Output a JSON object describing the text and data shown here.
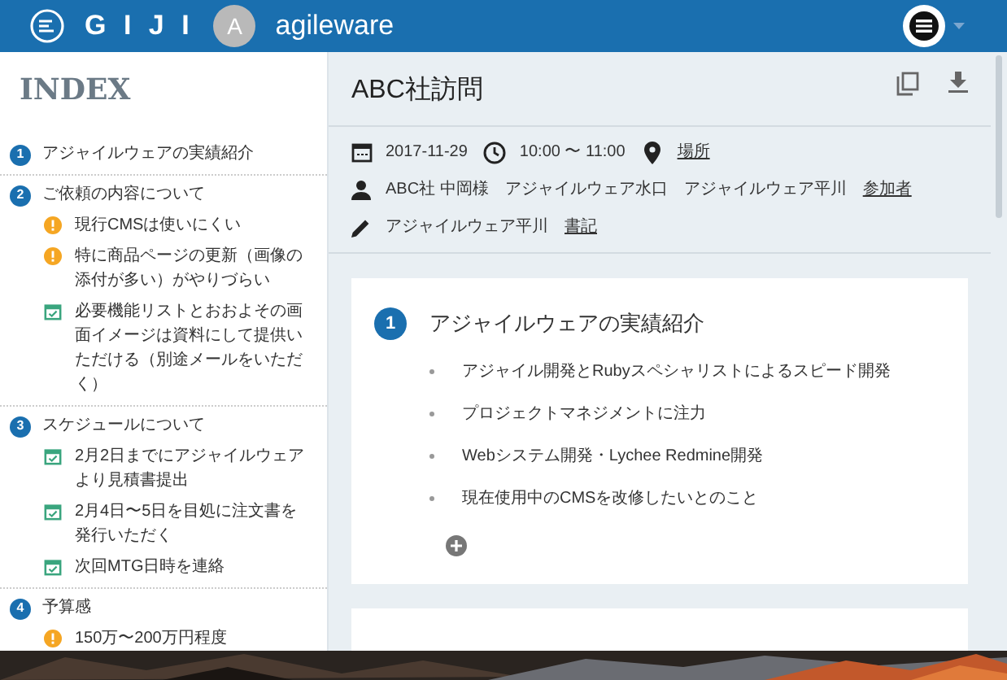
{
  "header": {
    "logo_text": "G I J I",
    "avatar_letter": "A",
    "org": "agileware"
  },
  "sidebar": {
    "title": "INDEX",
    "sections": [
      {
        "number": "1",
        "title": "アジャイルウェアの実績紹介"
      },
      {
        "number": "2",
        "title": "ご依頼の内容について",
        "items": [
          {
            "kind": "alert",
            "text": "現行CMSは使いにくい"
          },
          {
            "kind": "alert",
            "text": "特に商品ページの更新（画像の添付が多い）がやりづらい"
          },
          {
            "kind": "task",
            "text": "必要機能リストとおおよその画面イメージは資料にして提供いただける（別途メールをいただく）"
          }
        ]
      },
      {
        "number": "3",
        "title": "スケジュールについて",
        "items": [
          {
            "kind": "task",
            "text": "2月2日までにアジャイルウェアより見積書提出"
          },
          {
            "kind": "task",
            "text": "2月4日〜5日を目処に注文書を発行いただく"
          },
          {
            "kind": "task",
            "text": "次回MTG日時を連絡"
          }
        ]
      },
      {
        "number": "4",
        "title": "予算感",
        "items": [
          {
            "kind": "alert",
            "text": "150万〜200万円程度"
          }
        ]
      }
    ]
  },
  "main": {
    "title": "ABC社訪問",
    "meta": {
      "date": "2017-11-29",
      "time": "10:00 〜 11:00",
      "place_link": "場所",
      "attendees": [
        "ABC社 中岡様",
        "アジャイルウェア水口",
        "アジャイルウェア平川"
      ],
      "attendees_link": "参加者",
      "writer": "アジャイルウェア平川",
      "writer_link": "書記"
    },
    "topics": [
      {
        "number": "1",
        "title": "アジャイルウェアの実績紹介",
        "bullets": [
          "アジャイル開発とRubyスペシャリストによるスピード開発",
          "プロジェクトマネジメントに注力",
          "Webシステム開発・Lychee Redmine開発",
          "現在使用中のCMSを改修したいとのこと"
        ]
      }
    ]
  }
}
